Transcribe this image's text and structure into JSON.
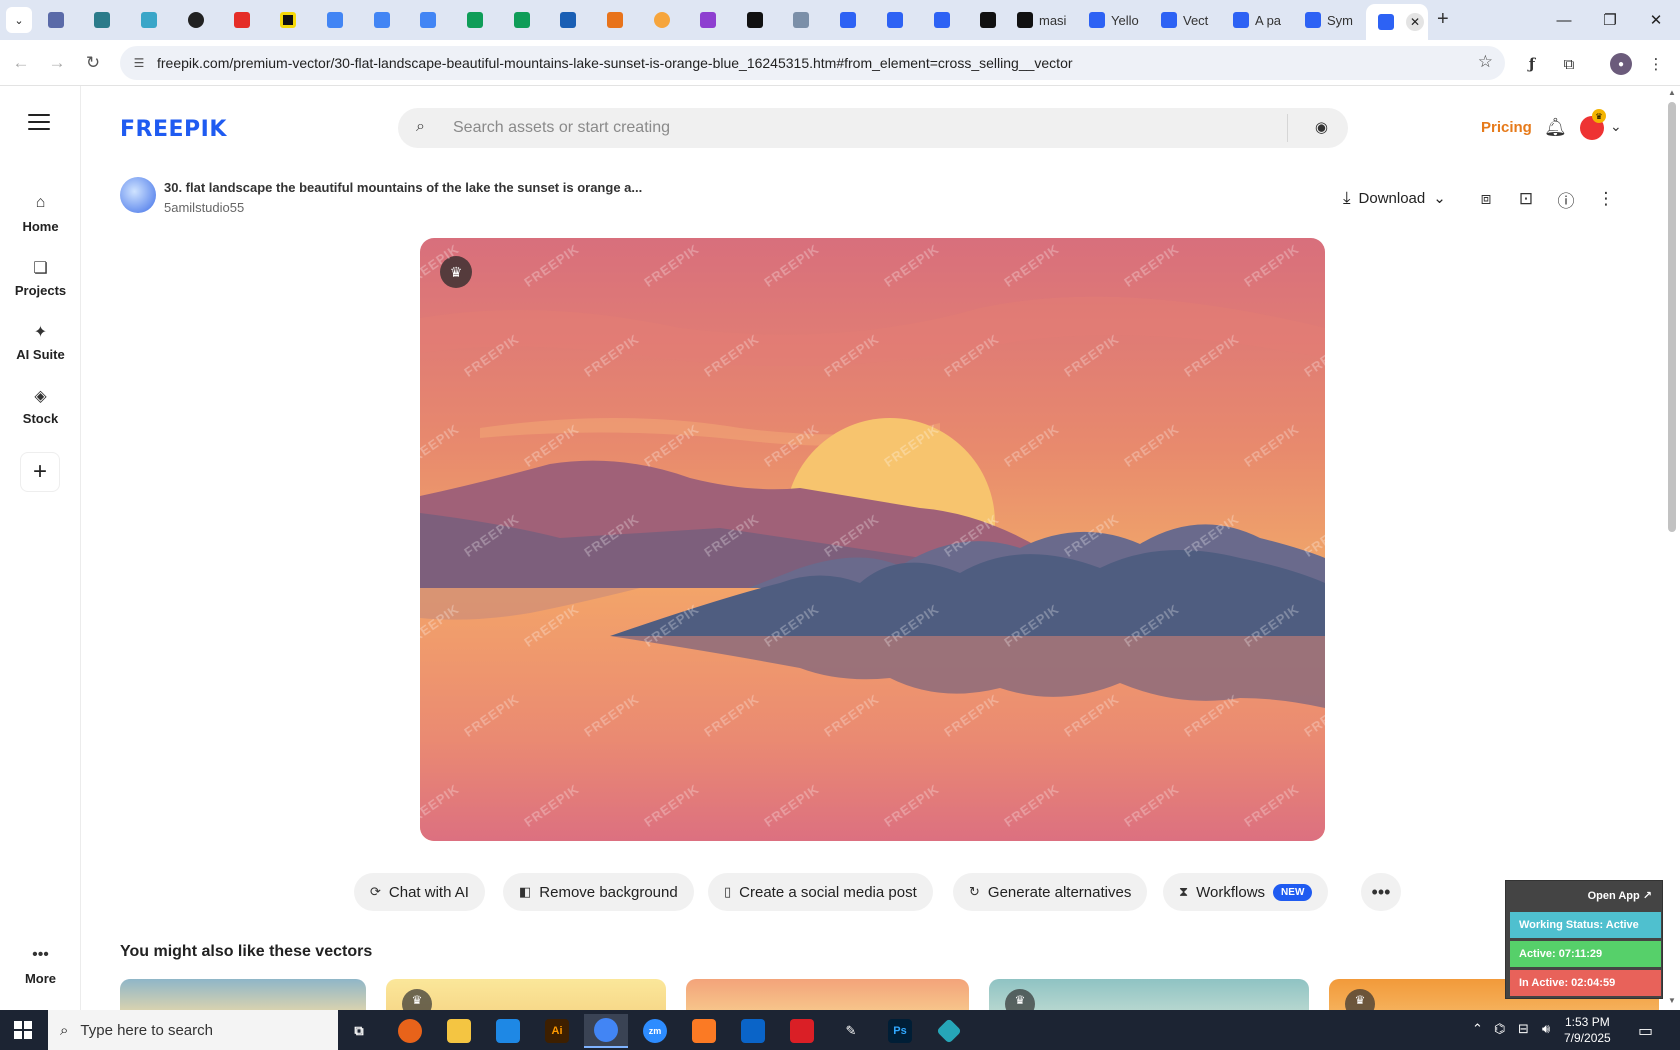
{
  "browser": {
    "tabs": [
      {
        "label": "",
        "color": "#5a6aa8"
      },
      {
        "label": "",
        "color": "#2b7b8a"
      },
      {
        "label": "",
        "color": "#3aa6c8"
      },
      {
        "label": "",
        "color": "#222222"
      },
      {
        "label": "",
        "color": "#e52d27"
      },
      {
        "label": "",
        "color": "#f5d90a"
      },
      {
        "label": "",
        "color": "#4285f4"
      },
      {
        "label": "",
        "color": "#4285f4"
      },
      {
        "label": "",
        "color": "#4285f4"
      },
      {
        "label": "",
        "color": "#0f9d58"
      },
      {
        "label": "",
        "color": "#0f9d58"
      },
      {
        "label": "",
        "color": "#1a5fb4"
      },
      {
        "label": "",
        "color": "#e8731a"
      },
      {
        "label": "",
        "color": "#f6a53c"
      },
      {
        "label": "",
        "color": "#8e3fd0"
      },
      {
        "label": "",
        "color": "#111111"
      },
      {
        "label": "",
        "color": "#7b8fa8"
      },
      {
        "label": "",
        "color": "#2d62f4"
      },
      {
        "label": "",
        "color": "#2d62f4"
      },
      {
        "label": "",
        "color": "#2d62f4"
      },
      {
        "label": "",
        "color": "#111111"
      },
      {
        "label": "masi",
        "color": "#111111"
      },
      {
        "label": "Yello",
        "color": "#2d62f4"
      },
      {
        "label": "Vect",
        "color": "#2d62f4"
      },
      {
        "label": "A pa",
        "color": "#2d62f4"
      },
      {
        "label": "Sym",
        "color": "#2d62f4"
      }
    ],
    "url": "freepik.com/premium-vector/30-flat-landscape-beautiful-mountains-lake-sunset-is-orange-blue_16245315.htm#from_element=cross_selling__vector"
  },
  "site": {
    "logo": "FREEPIK",
    "search_placeholder": "Search assets or start creating",
    "pricing": "Pricing"
  },
  "sidebar": {
    "items": [
      {
        "label": "Home",
        "icon": "home-icon"
      },
      {
        "label": "Projects",
        "icon": "projects-icon"
      },
      {
        "label": "AI Suite",
        "icon": "sparkle-icon"
      },
      {
        "label": "Stock",
        "icon": "stock-icon"
      }
    ],
    "more": "More"
  },
  "resource": {
    "title": "30. flat landscape the beautiful mountains of the lake the sunset is orange a...",
    "author": "5amilstudio55",
    "download": "Download",
    "watermark": "FREEPIK"
  },
  "tools": [
    {
      "label": "Chat with AI",
      "icon": "chat-icon"
    },
    {
      "label": "Remove background",
      "icon": "remove-bg-icon"
    },
    {
      "label": "Create a social media post",
      "icon": "phone-icon"
    },
    {
      "label": "Generate alternatives",
      "icon": "refresh-icon"
    },
    {
      "label": "Workflows",
      "icon": "workflow-icon",
      "badge": "NEW"
    }
  ],
  "related": {
    "heading": "You might also like these vectors"
  },
  "status_panel": {
    "open_app": "Open App ↗",
    "working_status": "Working Status: Active",
    "active": "Active: 07:11:29",
    "inactive": "In Active: 02:04:59",
    "colors": {
      "working": "#4fc0cf",
      "active": "#56d06a",
      "inactive": "#e8625a"
    }
  },
  "taskbar": {
    "search_placeholder": "Type here to search",
    "time": "1:53 PM",
    "date": "7/9/2025"
  },
  "colors": {
    "brand": "#1f5bf1",
    "pricing": "#e67a1a"
  }
}
